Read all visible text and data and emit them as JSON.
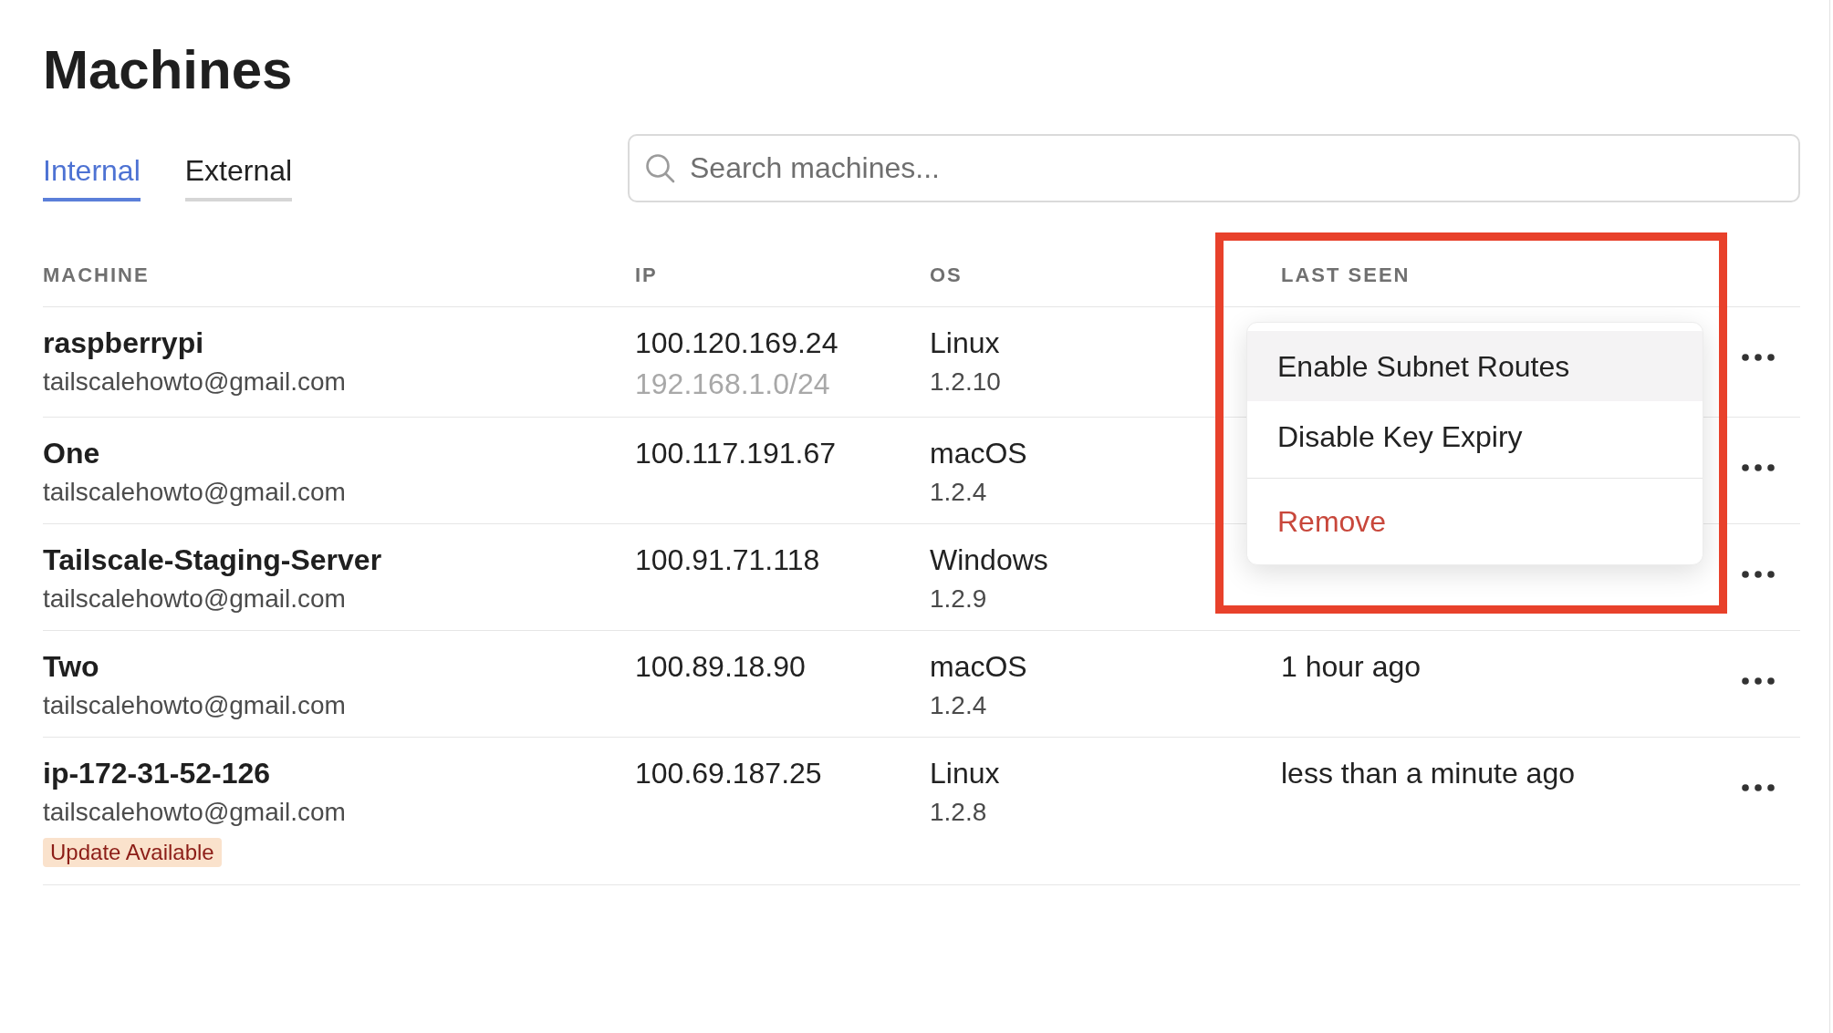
{
  "page": {
    "title": "Machines"
  },
  "tabs": [
    {
      "label": "Internal",
      "selected": true
    },
    {
      "label": "External",
      "selected": false
    }
  ],
  "search": {
    "placeholder": "Search machines..."
  },
  "table": {
    "columns": [
      "MACHINE",
      "IP",
      "OS",
      "LAST SEEN"
    ],
    "rows": [
      {
        "name": "raspberrypi",
        "owner": "tailscalehowto@gmail.com",
        "ip": "100.120.169.24",
        "subnet": "192.168.1.0/24",
        "os": "Linux",
        "version": "1.2.10",
        "menu_open": true
      },
      {
        "name": "One",
        "owner": "tailscalehowto@gmail.com",
        "ip": "100.117.191.67",
        "os": "macOS",
        "version": "1.2.4",
        "menu_open": false
      },
      {
        "name": "Tailscale-Staging-Server",
        "owner": "tailscalehowto@gmail.com",
        "ip": "100.91.71.118",
        "os": "Windows",
        "version": "1.2.9",
        "menu_open": false
      },
      {
        "name": "Two",
        "owner": "tailscalehowto@gmail.com",
        "ip": "100.89.18.90",
        "os": "macOS",
        "version": "1.2.4",
        "last_seen": "1 hour ago",
        "menu_open": false
      },
      {
        "name": "ip-172-31-52-126",
        "owner": "tailscalehowto@gmail.com",
        "ip": "100.69.187.25",
        "os": "Linux",
        "version": "1.2.8",
        "last_seen": "less than a minute ago",
        "badge": "Update Available",
        "menu_open": false
      }
    ]
  },
  "row_menu": {
    "items": [
      {
        "label": "Enable Subnet Routes",
        "kind": "action",
        "selected": true
      },
      {
        "label": "Disable Key Expiry",
        "kind": "action",
        "selected": false
      },
      {
        "label": "Remove",
        "kind": "danger",
        "selected": false
      }
    ]
  },
  "annotations": [
    {
      "kind": "frame"
    }
  ]
}
